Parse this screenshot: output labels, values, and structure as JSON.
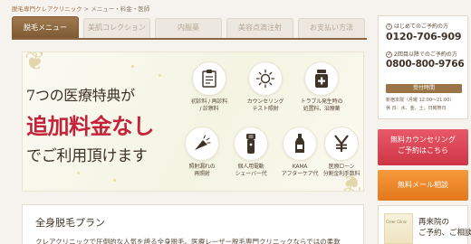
{
  "breadcrumb": {
    "home": "脱毛専門クレアクリニック",
    "separator": ">",
    "current": "メニュー・料金・医師"
  },
  "tabs": [
    {
      "label": "脱毛メニュー",
      "active": true
    },
    {
      "label": "美肌コレクション",
      "active": false
    },
    {
      "label": "内服薬",
      "active": false
    },
    {
      "label": "美容点滴注射",
      "active": false
    },
    {
      "label": "お支払い方法",
      "active": false
    }
  ],
  "hero": {
    "line1": "7つの医療特典が",
    "line2": "追加料金なし",
    "line3": "でご利用頂けます",
    "benefits": [
      {
        "icon": "clipboard-icon",
        "label": "初診料 / 再診料\n/ 診察料"
      },
      {
        "icon": "sun-icon",
        "label": "カウンセリング\nテスト照射"
      },
      {
        "icon": "medicine-bottle-icon",
        "label": "トラブル発生時の\n処置料、治療薬"
      },
      {
        "icon": "hair-shaving-icon",
        "label": "照射漏れの\n再照射"
      },
      {
        "icon": "electric-shaver-icon",
        "label": "個人用電動\nシェーバー代"
      },
      {
        "icon": "lotion-bottle-icon",
        "label": "KAMA\nアフターケア代"
      },
      {
        "icon": "yen-icon",
        "label": "医療ローン\n分割金利手数料"
      }
    ]
  },
  "plan": {
    "title": "全身脱毛プラン",
    "description": "クレアクリニックで圧倒的な人気を誇る全身脱毛。医療レーザー脱毛専門クリニックならではの柔軟"
  },
  "sidebar": {
    "first_time_label": "はじめてのご予約の方",
    "first_time_phone": "0120-706-909",
    "second_time_label": "2回目以降でのご予約の方",
    "second_time_phone": "0800-800-9766",
    "hours_badge": "受付時間",
    "hours_line1": "新宿本院（月曜 12:00〜21:00）",
    "hours_line2": "休 日：水、金、土、日曜祭日",
    "counseling_line1": "無料カウンセリング",
    "counseling_line2": "ご予約はこちら",
    "mail_label": "無料メール相談",
    "return_line1": "再来院の",
    "return_line2": "ご予約、ご相談",
    "return_thumb_text": "Creer Clinic"
  },
  "colors": {
    "accent_brown": "#8a6640",
    "accent_red": "#c4233a",
    "cta_pink": "#e04a5a",
    "cta_orange": "#f08a2c"
  }
}
